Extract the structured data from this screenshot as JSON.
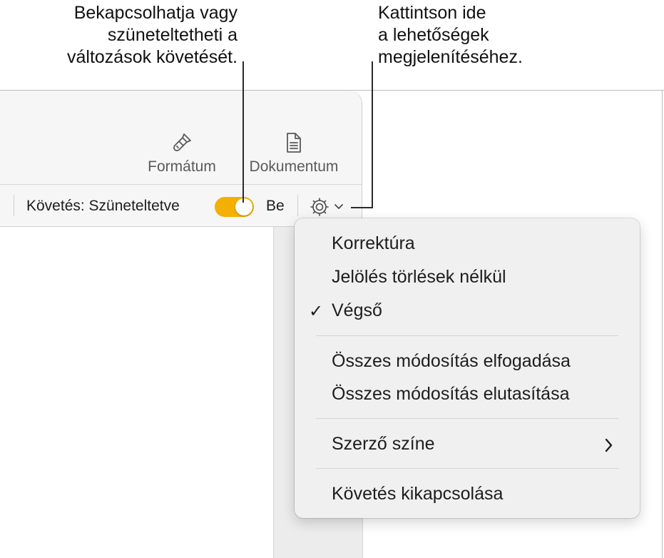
{
  "callouts": {
    "left": "Bekapcsolhatja vagy\nszüneteltetheti a\nváltozások követését.",
    "right": "Kattintson ide\na lehetőségek\nmegjelenítéséhez."
  },
  "toolbar": {
    "format_label": "Formátum",
    "format_icon": "paintbrush-icon",
    "document_label": "Dokumentum",
    "document_icon": "document-icon"
  },
  "tracking": {
    "status_label": "Követés: Szüneteltetve",
    "toggle_state": "on",
    "toggle_color": "#f4b000",
    "on_label": "Be",
    "options_icon": "gear-icon"
  },
  "menu": {
    "view_items": [
      {
        "label": "Korrektúra",
        "checked": false
      },
      {
        "label": "Jelölés törlések nélkül",
        "checked": false
      },
      {
        "label": "Végső",
        "checked": true
      }
    ],
    "change_items": [
      {
        "label": "Összes módosítás elfogadása"
      },
      {
        "label": "Összes módosítás elutasítása"
      }
    ],
    "author_color": {
      "label": "Szerző színe",
      "has_submenu": true
    },
    "turn_off": {
      "label": "Követés kikapcsolása"
    }
  }
}
